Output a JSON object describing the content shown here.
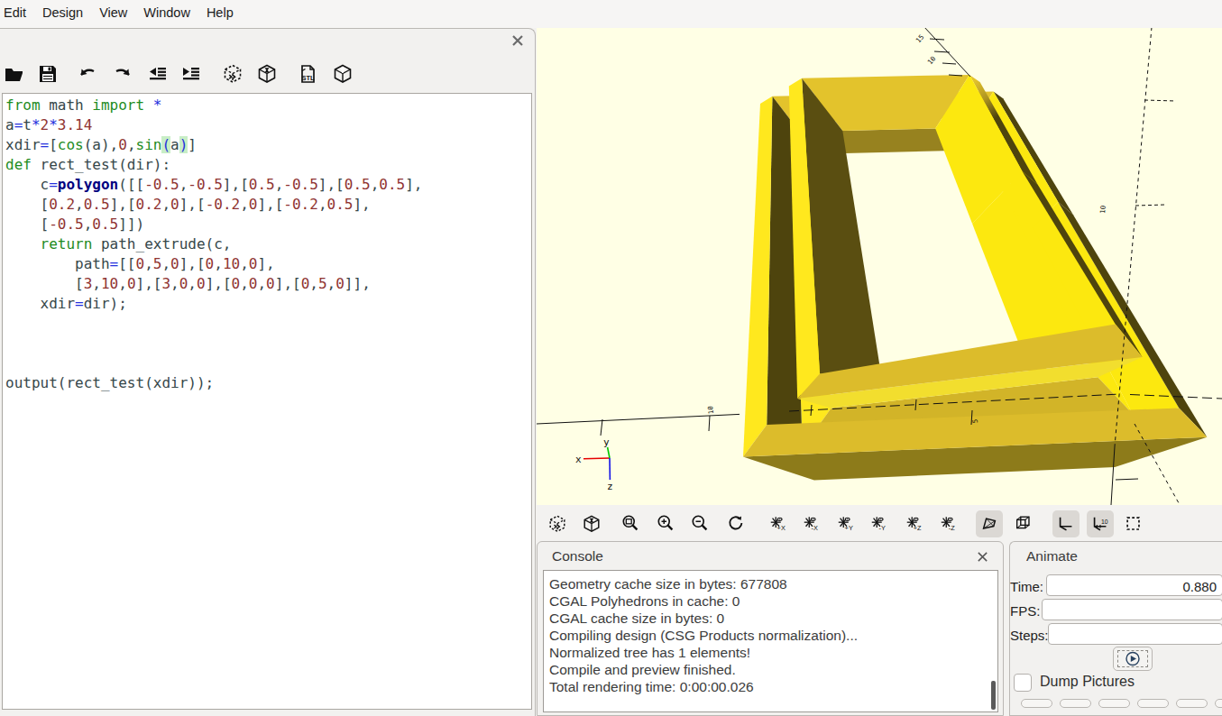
{
  "app": {
    "background": "#f3f2f0"
  },
  "menubar": {
    "items": [
      "Edit",
      "Design",
      "View",
      "Window",
      "Help"
    ]
  },
  "editor": {
    "toolbar_icons": [
      "open",
      "save",
      "undo",
      "redo",
      "unindent",
      "indent",
      "render-preview",
      "render",
      "export-stl",
      "export-3d"
    ],
    "close_label": "close",
    "lines": [
      [
        [
          "kw",
          "from"
        ],
        [
          "d",
          " math "
        ],
        [
          "kw",
          "import"
        ],
        [
          "d",
          " "
        ],
        [
          "op",
          "*"
        ]
      ],
      [
        [
          "d",
          "a"
        ],
        [
          "op",
          "="
        ],
        [
          "d",
          "t"
        ],
        [
          "op",
          "*"
        ],
        [
          "num",
          "2"
        ],
        [
          "op",
          "*"
        ],
        [
          "num",
          "3.14"
        ]
      ],
      [
        [
          "d",
          "xdir"
        ],
        [
          "op",
          "="
        ],
        [
          "d",
          "["
        ],
        [
          "kw",
          "cos"
        ],
        [
          "d",
          "(a),"
        ],
        [
          "num",
          "0"
        ],
        [
          "d",
          ","
        ],
        [
          "kw",
          "sin"
        ],
        [
          "mp",
          "("
        ],
        [
          "d",
          "a"
        ],
        [
          "mp",
          ")"
        ],
        [
          "d",
          "]"
        ]
      ],
      [
        [
          "kw",
          "def"
        ],
        [
          "d",
          " rect_test(dir):"
        ]
      ],
      [
        [
          "d",
          "    c"
        ],
        [
          "op",
          "="
        ],
        [
          "fn",
          "polygon"
        ],
        [
          "d",
          "([["
        ],
        [
          "num",
          "-0.5"
        ],
        [
          "d",
          ","
        ],
        [
          "num",
          "-0.5"
        ],
        [
          "d",
          "],["
        ],
        [
          "num",
          "0.5"
        ],
        [
          "d",
          ","
        ],
        [
          "num",
          "-0.5"
        ],
        [
          "d",
          "],["
        ],
        [
          "num",
          "0.5"
        ],
        [
          "d",
          ","
        ],
        [
          "num",
          "0.5"
        ],
        [
          "d",
          "],"
        ]
      ],
      [
        [
          "d",
          "    ["
        ],
        [
          "num",
          "0.2"
        ],
        [
          "d",
          ","
        ],
        [
          "num",
          "0.5"
        ],
        [
          "d",
          "],["
        ],
        [
          "num",
          "0.2"
        ],
        [
          "d",
          ","
        ],
        [
          "num",
          "0"
        ],
        [
          "d",
          "],["
        ],
        [
          "num",
          "-0.2"
        ],
        [
          "d",
          ","
        ],
        [
          "num",
          "0"
        ],
        [
          "d",
          "],["
        ],
        [
          "num",
          "-0.2"
        ],
        [
          "d",
          ","
        ],
        [
          "num",
          "0.5"
        ],
        [
          "d",
          "],"
        ]
      ],
      [
        [
          "d",
          "    ["
        ],
        [
          "num",
          "-0.5"
        ],
        [
          "d",
          ","
        ],
        [
          "num",
          "0.5"
        ],
        [
          "d",
          "]])"
        ]
      ],
      [
        [
          "d",
          "    "
        ],
        [
          "kw",
          "return"
        ],
        [
          "d",
          " path_extrude(c,"
        ]
      ],
      [
        [
          "d",
          "        path"
        ],
        [
          "op",
          "="
        ],
        [
          "d",
          "[["
        ],
        [
          "num",
          "0"
        ],
        [
          "d",
          ","
        ],
        [
          "num",
          "5"
        ],
        [
          "d",
          ","
        ],
        [
          "num",
          "0"
        ],
        [
          "d",
          "],["
        ],
        [
          "num",
          "0"
        ],
        [
          "d",
          ","
        ],
        [
          "num",
          "10"
        ],
        [
          "d",
          ","
        ],
        [
          "num",
          "0"
        ],
        [
          "d",
          "],"
        ]
      ],
      [
        [
          "d",
          "        ["
        ],
        [
          "num",
          "3"
        ],
        [
          "d",
          ","
        ],
        [
          "num",
          "10"
        ],
        [
          "d",
          ","
        ],
        [
          "num",
          "0"
        ],
        [
          "d",
          "],["
        ],
        [
          "num",
          "3"
        ],
        [
          "d",
          ","
        ],
        [
          "num",
          "0"
        ],
        [
          "d",
          ","
        ],
        [
          "num",
          "0"
        ],
        [
          "d",
          "],["
        ],
        [
          "num",
          "0"
        ],
        [
          "d",
          ","
        ],
        [
          "num",
          "0"
        ],
        [
          "d",
          ","
        ],
        [
          "num",
          "0"
        ],
        [
          "d",
          "],["
        ],
        [
          "num",
          "0"
        ],
        [
          "d",
          ","
        ],
        [
          "num",
          "5"
        ],
        [
          "d",
          ","
        ],
        [
          "num",
          "0"
        ],
        [
          "d",
          "]],"
        ]
      ],
      [
        [
          "d",
          "    xdir"
        ],
        [
          "op",
          "="
        ],
        [
          "d",
          "dir);"
        ]
      ],
      [],
      [],
      [],
      [
        [
          "d",
          "output(rect_test(xdir));"
        ]
      ]
    ]
  },
  "viewport": {
    "background": "#ffffe5",
    "object_colors": {
      "bright": "#fce80f",
      "gold": "#e3c32c",
      "lip": "#97821f",
      "underside": "#8d7b1a",
      "dark": "#5a4e11",
      "bevel": "#f2de2e"
    },
    "axis_labels": {
      "x": "x",
      "y": "y",
      "z": "z"
    },
    "scale_labels": {
      "x10": "10",
      "x5": "5",
      "z10": "10",
      "y15": "15",
      "y10": "10"
    }
  },
  "view_toolbar": {
    "icons": [
      "preview",
      "render",
      "zoom-all",
      "zoom-in",
      "zoom-out",
      "reset-view",
      "view-plus-x",
      "view-minus-x",
      "view-plus-y",
      "view-minus-y",
      "view-plus-z",
      "view-minus-z",
      "perspective",
      "orthogonal",
      "show-axes",
      "show-scale-markers",
      "show-edges"
    ],
    "axis_icon_labels": [
      "+X",
      "-X",
      "+Y",
      "-Y",
      "+Z",
      "-Z"
    ],
    "pressed": [
      "perspective",
      "show-axes",
      "show-scale-markers"
    ]
  },
  "console": {
    "title": "Console",
    "close_label": "close",
    "lines": [
      "Geometry cache size in bytes: 677808",
      "CGAL Polyhedrons in cache: 0",
      "CGAL cache size in bytes: 0",
      "Compiling design (CSG Products normalization)...",
      "Normalized tree has 1 elements!",
      "Compile and preview finished.",
      "Total rendering time: 0:00:00.026"
    ]
  },
  "animate": {
    "title": "Animate",
    "fields": [
      {
        "label": "Time:",
        "value": "0.880"
      },
      {
        "label": "FPS:",
        "value": ""
      },
      {
        "label": "Steps:",
        "value": ""
      }
    ],
    "play_label": "play",
    "dump_label": "Dump Pictures",
    "dump_checked": false
  }
}
